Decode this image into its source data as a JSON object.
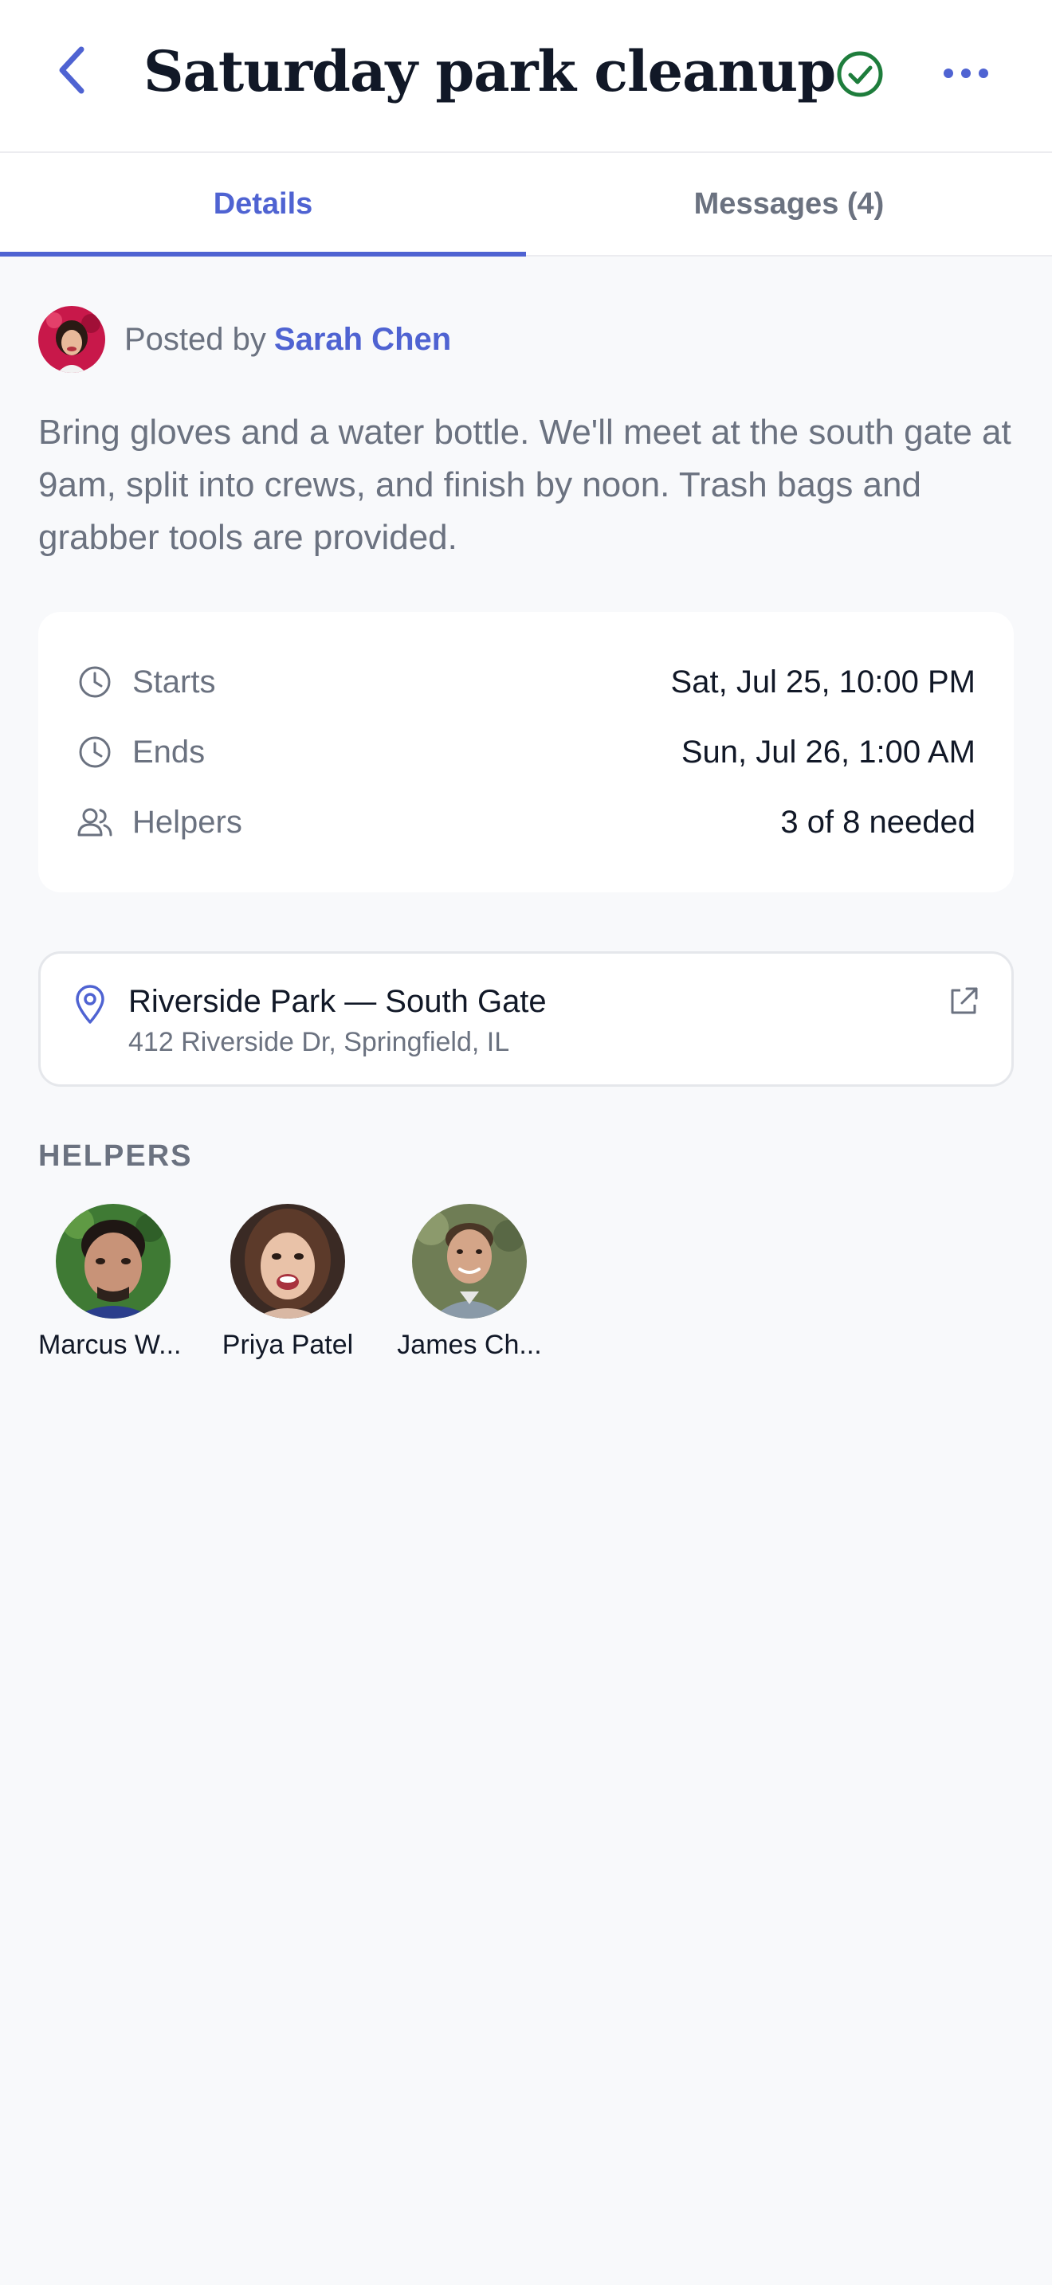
{
  "header": {
    "title": "Saturday park cleanup",
    "accent_color": "#4f63d2",
    "check_color": "#1e7d3c"
  },
  "tabs": [
    {
      "label": "Details",
      "active": true
    },
    {
      "label": "Messages (4)",
      "active": false
    }
  ],
  "posted": {
    "prefix": "Posted by",
    "author": "Sarah Chen"
  },
  "description": "Bring gloves and a water bottle. We'll meet at the south gate at 9am, split into crews, and finish by noon. Trash bags and grabber tools are provided.",
  "info": {
    "starts_label": "Starts",
    "starts_value": "Sat, Jul 25, 10:00 PM",
    "ends_label": "Ends",
    "ends_value": "Sun, Jul 26, 1:00 AM",
    "helpers_label": "Helpers",
    "helpers_value": "3 of 8 needed"
  },
  "location": {
    "name": "Riverside Park — South Gate",
    "address": "412 Riverside Dr, Springfield, IL"
  },
  "helpers_section": {
    "heading": "HELPERS",
    "people": [
      {
        "name": "Marcus W..."
      },
      {
        "name": "Priya Patel"
      },
      {
        "name": "James Ch..."
      }
    ]
  }
}
